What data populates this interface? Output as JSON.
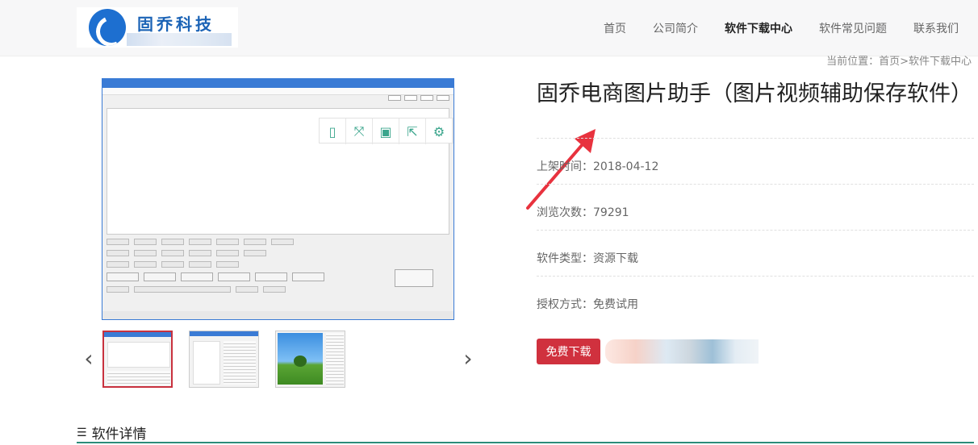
{
  "header": {
    "logo_text": "固乔科技",
    "nav": [
      {
        "label": "首页",
        "active": false
      },
      {
        "label": "公司简介",
        "active": false
      },
      {
        "label": "软件下载中心",
        "active": true
      },
      {
        "label": "软件常见问题",
        "active": false
      },
      {
        "label": "联系我们",
        "active": false
      }
    ]
  },
  "breadcrumb": "当前位置：首页>软件下载中心",
  "product": {
    "title": "固乔电商图片助手（图片视频辅助保存软件）",
    "info": [
      {
        "label": "上架时间：2018-04-12"
      },
      {
        "label": "浏览次数：79291"
      },
      {
        "label": "软件类型：资源下载"
      },
      {
        "label": "授权方式：免费试用"
      }
    ],
    "download_label": "免费下载"
  },
  "gallery": {
    "main_toolbar_icons": [
      "tablet-icon",
      "fullscreen-icon",
      "save-icon",
      "share-icon",
      "settings-icon"
    ],
    "prev_arrow": "‹",
    "next_arrow": "›",
    "thumbnail_count": 3,
    "selected_index": 0
  },
  "section": {
    "detail_title": "软件详情",
    "detail_icon": "sliders-icon"
  },
  "colors": {
    "accent": "#d0313e",
    "brand_blue": "#1b63b6",
    "toolbar_icon": "#3aa58c",
    "section_line": "#2c8c7a"
  }
}
